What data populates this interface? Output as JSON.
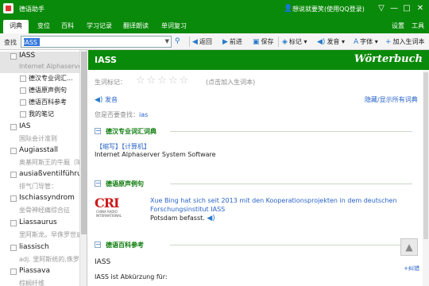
{
  "app": {
    "title": "德语助手",
    "user": "想说就要笑(使用QQ登录)",
    "user_icon": "person-icon",
    "window_controls": [
      "▽",
      "—",
      "□",
      "✕"
    ]
  },
  "nav": {
    "tabs": [
      "词典",
      "变位",
      "百科",
      "学习记录",
      "翻译朗读",
      "单词复习"
    ],
    "right": [
      "设置",
      "工具"
    ]
  },
  "toolbar": {
    "search_label": "查找",
    "search_value": "IASS",
    "buttons": {
      "back": "返回",
      "forward": "前进",
      "save": "保存",
      "mark": "标记",
      "pronounce": "发音",
      "font": "字体",
      "add_word": "加入生词本"
    }
  },
  "sidebar": {
    "entries": [
      {
        "word": "IASS",
        "sub": "Internet Alphaserver"
      },
      {
        "word": "IAS",
        "sub": "国际会计准则"
      },
      {
        "word": "Augiasstall",
        "sub": "奥基阿斯王的牛厩（喻"
      },
      {
        "word": "ausiaßventilführu",
        "sub": "排气门导管："
      },
      {
        "word": "Ischiassyndrom",
        "sub": "坐骨神经痛综合征"
      },
      {
        "word": "Liassaurus",
        "sub": "里阿斯龙。早侏罗世或"
      },
      {
        "word": "liassisch",
        "sub": "adj. 里阿斯统的,侏罗"
      },
      {
        "word": "Piassava",
        "sub": "棕榈纤维"
      }
    ],
    "children": [
      "德汉专业词汇...",
      "德语原声例句",
      "德语百科参考",
      "我的笔记"
    ]
  },
  "content": {
    "title": "IASS",
    "brand": "Wörterbuch",
    "rating_label": "生词标记：",
    "stars": "☆☆☆☆☆",
    "add_hint": "(点击加入生词本)",
    "pronounce": "发音",
    "toggle_all": "隐藏/显示所有词典",
    "prev_search_label": "您是否要查找：",
    "prev_search_link": "ias",
    "sections": {
      "dict": "德汉专业词汇词典",
      "examples": "德语原声例句",
      "encyclopedia": "德语百科参考"
    },
    "dict_tags": "【缩写】【计算机】",
    "dict_def": "Internet Alphaserver System Software",
    "example_text": "Xue Bing hat sich seit 2013 mit den Kooperationsprojekten in dem deutschen Forschungsinstitut",
    "example_hl": "IASS",
    "example_end": "Potsdam befasst.",
    "logo": "CRI",
    "logo_sub": "CHINA RADIO INTERNATIONAL",
    "enc_title": "IASS",
    "enc_text": "IASS ist Abkürzung für:",
    "float_btn": "▲",
    "correction": "+纠错"
  }
}
